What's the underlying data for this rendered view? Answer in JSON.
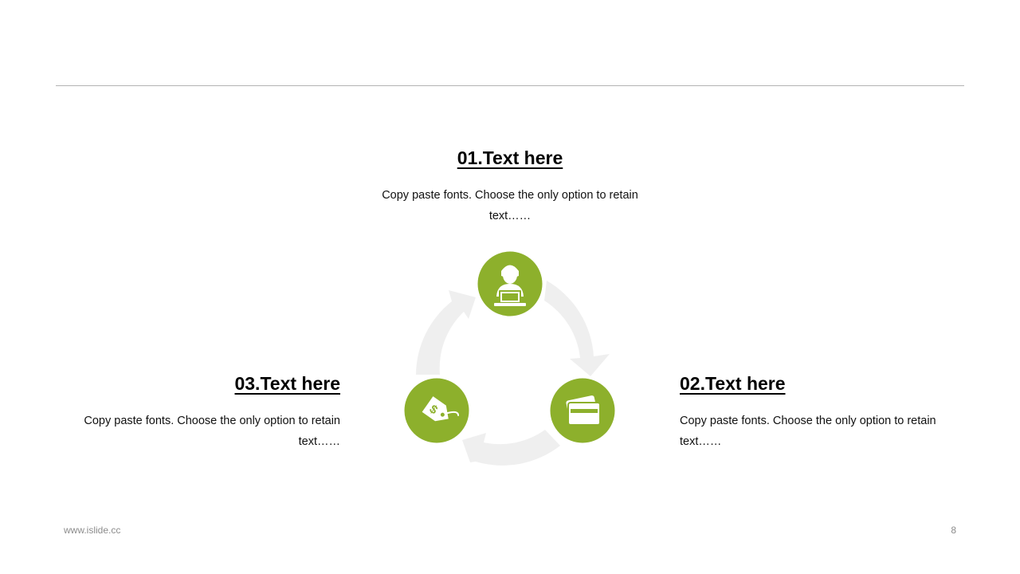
{
  "items": [
    {
      "title": "01.Text here",
      "text": "Copy paste fonts. Choose the only option to retain text……",
      "icon": "user-laptop-icon"
    },
    {
      "title": "02.Text here",
      "text": "Copy paste fonts. Choose the only option to retain text……",
      "icon": "credit-card-icon"
    },
    {
      "title": "03.Text here",
      "text": "Copy paste fonts. Choose the only option to retain text……",
      "icon": "price-tag-icon"
    }
  ],
  "footer": {
    "website": "www.islide.cc",
    "page_number": "8"
  },
  "colors": {
    "accent": "#8db02c",
    "arrow": "#efefef",
    "rule": "#b3b3b3"
  }
}
